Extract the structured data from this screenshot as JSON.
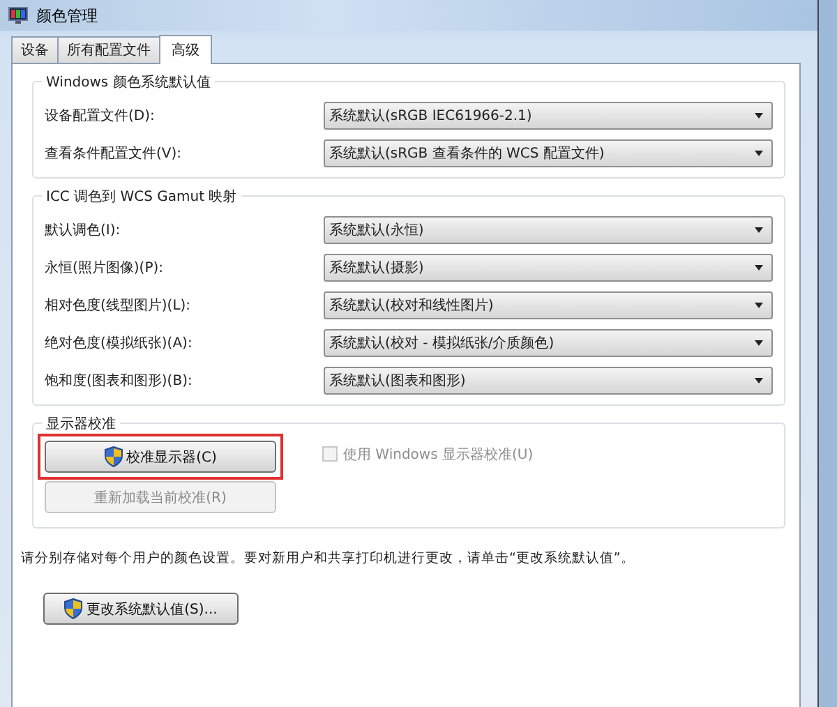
{
  "window": {
    "title": "颜色管理"
  },
  "tabs": [
    {
      "label": "设备",
      "selected": false
    },
    {
      "label": "所有配置文件",
      "selected": false
    },
    {
      "label": "高级",
      "selected": true
    }
  ],
  "groups": [
    {
      "title": "Windows 颜色系统默认值",
      "rows": [
        {
          "label": "设备配置文件(D):",
          "value": "系统默认(sRGB IEC61966-2.1)"
        },
        {
          "label": "查看条件配置文件(V):",
          "value": "系统默认(sRGB 查看条件的 WCS 配置文件)"
        }
      ]
    },
    {
      "title": "ICC 调色到 WCS Gamut 映射",
      "rows": [
        {
          "label": "默认调色(I):",
          "value": "系统默认(永恒)"
        },
        {
          "label": "永恒(照片图像)(P):",
          "value": "系统默认(摄影)"
        },
        {
          "label": "相对色度(线型图片)(L):",
          "value": "系统默认(校对和线性图片)"
        },
        {
          "label": "绝对色度(模拟纸张)(A):",
          "value": "系统默认(校对 - 模拟纸张/介质颜色)"
        },
        {
          "label": "饱和度(图表和图形)(B):",
          "value": "系统默认(图表和图形)"
        }
      ]
    }
  ],
  "calibration": {
    "title": "显示器校准",
    "calibrate_button": {
      "label": "校准显示器(C)",
      "highlighted": true
    },
    "reload_button": {
      "label": "重新加载当前校准(R)",
      "disabled": true
    },
    "use_windows_calibration": {
      "label": "使用 Windows 显示器校准(U)",
      "checked": false,
      "disabled": true
    }
  },
  "note": "请分别存储对每个用户的颜色设置。要对新用户和共享打印机进行更改，请单击“更改系统默认值”。",
  "change_defaults_button": {
    "label": "更改系统默认值(S)..."
  }
}
